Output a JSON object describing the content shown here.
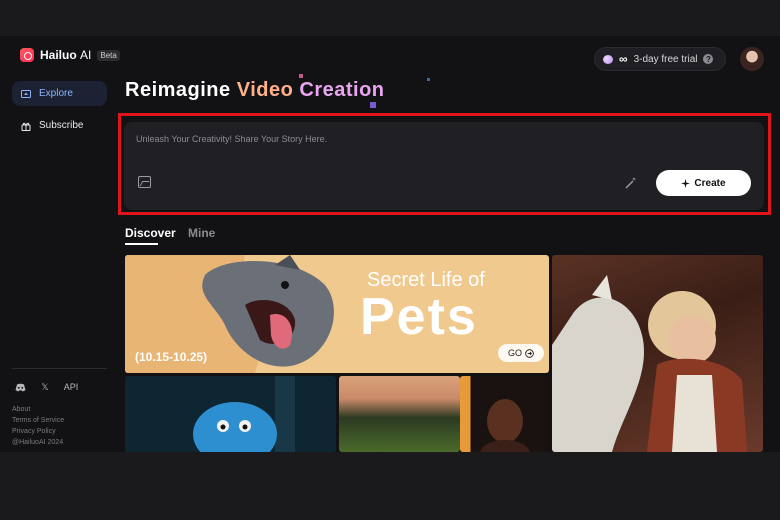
{
  "app": {
    "name": "Hailuo",
    "name_suffix": "AI",
    "badge": "Beta"
  },
  "header": {
    "trial_symbol": "∞",
    "trial_text": "3-day free trial",
    "help_symbol": "?"
  },
  "sidebar": {
    "items": [
      {
        "label": "Explore",
        "icon": "compass-icon",
        "active": true
      },
      {
        "label": "Subscribe",
        "icon": "gift-icon",
        "active": false
      }
    ],
    "social": [
      {
        "icon": "discord-icon"
      },
      {
        "icon": "x-icon",
        "glyph": "𝕏"
      },
      {
        "label": "API"
      }
    ],
    "footer": [
      "About",
      "Terms of Service",
      "Privacy Policy",
      "@HailuoAI 2024"
    ]
  },
  "hero": {
    "word1": "Reimagine",
    "word2": "Video",
    "word3": "Creation"
  },
  "prompt": {
    "placeholder": "Unleash Your Creativity! Share Your Story Here.",
    "create_label": "Create",
    "create_icon": "sparkle-icon"
  },
  "tabs": [
    {
      "label": "Discover",
      "active": true
    },
    {
      "label": "Mine",
      "active": false
    }
  ],
  "gallery": {
    "featured": {
      "title_line1": "Secret Life of",
      "title_line2": "Pets",
      "date": "(10.15-10.25)",
      "go_label": "GO"
    }
  },
  "colors": {
    "accent_blue": "#8fb4ff",
    "hero_video": "#ffb08a",
    "hero_creation": "#e9a6f0",
    "highlight_red": "#e0141b"
  }
}
